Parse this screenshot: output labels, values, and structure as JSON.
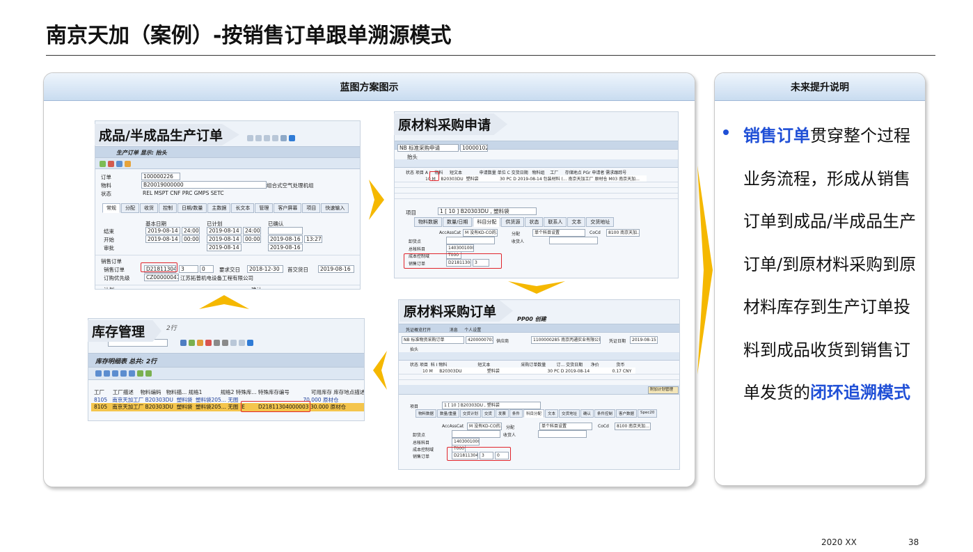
{
  "page": {
    "title": "南京天加（案例）-按销售订单跟单溯源模式",
    "footer_left": "2020 XX",
    "page_number": "38"
  },
  "left_panel": {
    "header": "蓝图方案图示",
    "shots": {
      "production_order": {
        "label": "成品/半成品生产订单",
        "window_title": "生产订单 显示: 抬头",
        "order_label": "订单",
        "order_value": "100000226",
        "material_label": "物料",
        "material_value": "B20019000000",
        "material_desc": "组合式空气处理机组",
        "status_label": "状态",
        "status_value": "REL MSPT CNF PRC GMPS SETC",
        "tabs": [
          "常规",
          "分配",
          "收货",
          "控制",
          "日期/数量",
          "主数据",
          "长文本",
          "管理",
          "客户屏幕",
          "项目",
          "快速输入"
        ],
        "col_basic": "基本日期",
        "col_plan": "已计划",
        "col_confirm": "已确认",
        "end_label": "结束",
        "end_date": "2019-08-14",
        "end_time": "24:00",
        "end_plan_date": "2019-08-14",
        "end_plan_time": "24:00",
        "start_label": "开始",
        "start_date": "2019-08-14",
        "start_time": "00:00",
        "start_plan_date": "2019-08-14",
        "start_plan_time": "00:00",
        "start_conf_date": "2019-08-16",
        "start_conf_time": "13:27",
        "release_label": "审批",
        "release_plan_date": "2019-08-14",
        "release_conf_date": "2019-08-16",
        "so_section": "销售订单",
        "so_label": "销售订单",
        "so_value": "D21811304",
        "so_item": "3",
        "so_zero": "0",
        "req_date_label": "要求交日",
        "req_date": "2018-12-30",
        "first_date_label": "首交货日",
        "first_date": "2019-08-16",
        "customer_label": "订购优先级",
        "customer_code": "CZ00000047",
        "customer_name": "江苏拓普机电设备工程有限公司",
        "plan_label": "计划",
        "confirm_label": "确认"
      },
      "purchase_requisition": {
        "label": "原材料采购申请",
        "doc_type": "NB 标准采购申请",
        "doc_number": "1000010207",
        "header_label": "抬头",
        "columns": [
          "状态",
          "项目",
          "A",
          "I",
          "物料",
          "短文本",
          "申请数量",
          "单位",
          "C",
          "交货日期",
          "物料组",
          "工厂",
          "存储地点",
          "PGr",
          "申请者",
          "需求跟踪号"
        ],
        "row_item": "10",
        "row_a": "M",
        "row_material": "B20303DU",
        "row_text": "塑料袋",
        "row_qty": "30",
        "row_unit": "PC",
        "row_c": "D",
        "row_date": "2019-08-14",
        "row_group": "包装材料 (...",
        "row_plant": "南京天加工厂",
        "row_sloc": "原材仓",
        "row_pgr": "M03",
        "row_req": "南京天加...",
        "item_label": "项目",
        "item_value": "1 [ 10 ] B20303DU , 塑料袋",
        "tabs": [
          "物料数据",
          "数量/日期",
          "科目分配",
          "供货源",
          "状态",
          "联系人",
          "文本",
          "交货地址"
        ],
        "acc_label": "AccAssCat",
        "acc_value": "M 没有KD-CO的...",
        "dist_label": "分配",
        "dist_value": "单个科目设置",
        "coco_label": "CoCd",
        "coco_value": "8100 南京天加...",
        "unload_label": "卸货点",
        "recipient_label": "收货人",
        "gl_label": "总帐科目",
        "gl_value": "1403001000",
        "cc_label": "成本控制域",
        "cc_value": "T000",
        "so_label": "销售订单",
        "so_value": "D21811304",
        "so_item": "3"
      },
      "purchase_order": {
        "label": "原材料采购订单",
        "window_title": "PP00 创建",
        "doc_type": "NB 标准物资采购订单",
        "doc_number": "4200000703",
        "vendor_label": "供应商",
        "vendor_value": "1100000285 南京丙通实业有限公司",
        "doc_date_label": "凭证日期",
        "doc_date": "2019-08-15",
        "menu_items": [
          "凭证概览打开",
          "消息",
          "个人设置"
        ],
        "header_label": "抬头",
        "columns": [
          "状态",
          "项目",
          "科",
          "I",
          "物料",
          "短文本",
          "采购订单数量",
          "订...",
          "交货日期",
          "净价",
          "货币"
        ],
        "row_item": "10",
        "row_k": "M",
        "row_material": "B20303DU",
        "row_text": "塑料袋",
        "row_qty": "30",
        "row_unit": "PC",
        "row_c": "D",
        "row_date": "2019-08-14",
        "row_price": "0.17",
        "row_cur": "CNY",
        "item_label": "项目",
        "item_value": "1 [ 10 ] B20303DU , 塑料袋",
        "tabs": [
          "物料数据",
          "数量/重量",
          "交货计划",
          "交货",
          "发票",
          "条件",
          "科目分配",
          "文本",
          "交货地址",
          "确认",
          "条件控制",
          "客户数据",
          "Spec20"
        ],
        "acc_label": "AccAssCat",
        "acc_value": "M 没有KD-CO的...",
        "dist_label": "分配",
        "dist_value": "单个科目设置",
        "coco_label": "CoCd",
        "coco_value": "8100 南京天加...",
        "unload_label": "卸货点",
        "recipient_label": "收货人",
        "gl_label": "总帐科目",
        "gl_value": "1403001000",
        "cc_label": "成本控制域",
        "cc_value": "T000",
        "so_label": "销售订单",
        "so_value": "D21811304",
        "so_item": "3",
        "so_zero": "0",
        "extra_button": "附加计划管理"
      },
      "inventory": {
        "label": "库存管理",
        "row_count": "2行",
        "window_title": "库存明细表 总共: 2行",
        "columns": [
          "工厂",
          "工厂描述",
          "物料编码",
          "物料描...",
          "规格1",
          "规格2",
          "特殊库...",
          "特殊库存编号",
          "可用库存",
          "库存地点描述"
        ],
        "rows": [
          {
            "plant": "8105",
            "plant_desc": "南京天加工厂",
            "material": "B20303DU",
            "mat_desc": "塑料袋",
            "spec1": "塑料袋205...",
            "spec2": "无图",
            "special": "",
            "special_no": "",
            "qty": "70.000",
            "sloc": "原材仓"
          },
          {
            "plant": "8105",
            "plant_desc": "南京天加工厂",
            "material": "B20303DU",
            "mat_desc": "塑料袋",
            "spec1": "塑料袋205...",
            "spec2": "无图",
            "special": "E",
            "special_no": "D21811304000003",
            "qty": "30.000",
            "sloc": "原材仓"
          }
        ]
      }
    }
  },
  "right_panel": {
    "header": "未来提升说明",
    "description_highlight_1": "销售订单",
    "description_body": "贯穿整个过程业务流程，形成从销售订单到成品/半成品生产订单/到原材料采购到原材料库存到生产订单投料到成品收货到销售订单发货的",
    "description_highlight_2": "闭环追溯模式"
  },
  "colors": {
    "accent_blue": "#1f4fd6",
    "arrow_gold": "#f5b800",
    "red_box": "#e0242b",
    "panel_head_top": "#eef5fc",
    "panel_head_bottom": "#c9dcf0"
  }
}
